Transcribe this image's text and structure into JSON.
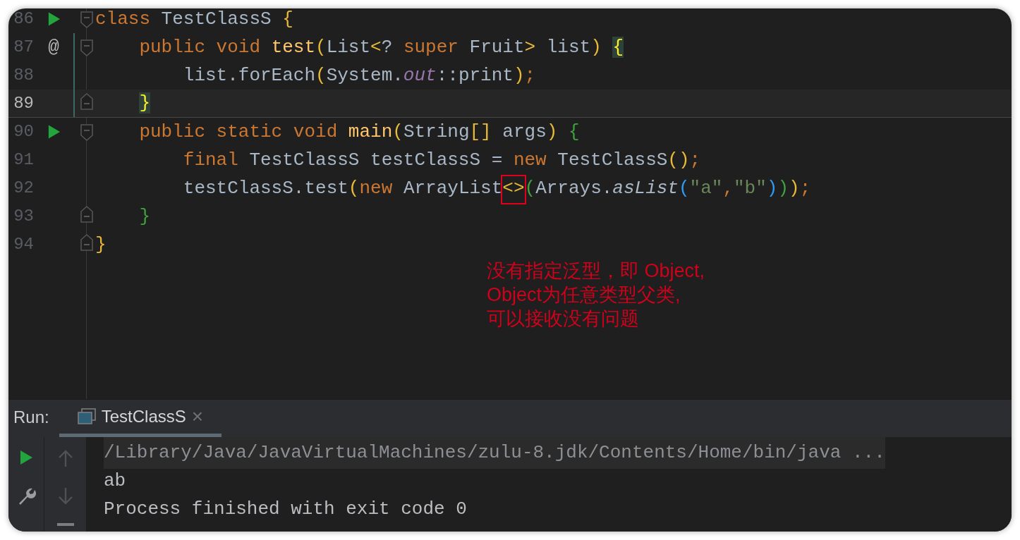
{
  "editor": {
    "lines": [
      {
        "number": "86",
        "gutter_icon": {
          "kind": "run"
        },
        "fold_marker": {
          "kind": "start"
        },
        "current": false,
        "changed": false,
        "separator_after": false,
        "tokens": [
          {
            "text": "class",
            "kind": "keyword"
          },
          {
            "text": " TestClassS ",
            "kind": "plain"
          },
          {
            "text": "{",
            "kind": "bracket1"
          }
        ],
        "children": [
          {
            "number": "87",
            "gutter_icon": {
              "kind": "text",
              "text": "@"
            },
            "fold_marker": {
              "kind": "start"
            },
            "current": false,
            "changed": true,
            "separator_after": false,
            "tokens": [
              {
                "text": "public void ",
                "kind": "keyword"
              },
              {
                "text": "test",
                "kind": "method"
              },
              {
                "text": "(",
                "kind": "bracket1"
              },
              {
                "text": "List",
                "kind": "plain"
              },
              {
                "text": "<",
                "kind": "bracket1"
              },
              {
                "text": "? ",
                "kind": "plain"
              },
              {
                "text": "super ",
                "kind": "keyword"
              },
              {
                "text": "Fruit",
                "kind": "plain"
              },
              {
                "text": ">",
                "kind": "bracket1"
              },
              {
                "text": " list",
                "kind": "plain"
              },
              {
                "text": ") ",
                "kind": "bracket1"
              },
              {
                "text": "{",
                "kind": "brace_match"
              }
            ],
            "children": [
              {
                "number": "88",
                "current": false,
                "changed": true,
                "separator_after": false,
                "tokens": [
                  {
                    "text": "list.forEach",
                    "kind": "plain"
                  },
                  {
                    "text": "(",
                    "kind": "bracket1"
                  },
                  {
                    "text": "System.",
                    "kind": "plain"
                  },
                  {
                    "text": "out",
                    "kind": "static_field"
                  },
                  {
                    "text": "::print",
                    "kind": "plain"
                  },
                  {
                    "text": ")",
                    "kind": "bracket1"
                  },
                  {
                    "text": ";",
                    "kind": "punct"
                  }
                ]
              }
            ]
          },
          {
            "number": "89",
            "fold_marker": {
              "kind": "end"
            },
            "current": true,
            "changed": true,
            "separator_after": true,
            "tokens": [
              {
                "text": "}",
                "kind": "brace_match"
              }
            ]
          },
          {
            "number": "90",
            "gutter_icon": {
              "kind": "run"
            },
            "fold_marker": {
              "kind": "start"
            },
            "current": false,
            "changed": false,
            "separator_after": false,
            "tokens": [
              {
                "text": "public static void ",
                "kind": "keyword"
              },
              {
                "text": "main",
                "kind": "method"
              },
              {
                "text": "(",
                "kind": "bracket1"
              },
              {
                "text": "String",
                "kind": "plain"
              },
              {
                "text": "[]",
                "kind": "bracket1"
              },
              {
                "text": " args",
                "kind": "plain"
              },
              {
                "text": ") ",
                "kind": "bracket1"
              },
              {
                "text": "{",
                "kind": "bracket2"
              }
            ],
            "children": [
              {
                "number": "91",
                "current": false,
                "changed": false,
                "separator_after": false,
                "tokens": [
                  {
                    "text": "final ",
                    "kind": "keyword"
                  },
                  {
                    "text": "TestClassS testClassS = ",
                    "kind": "plain"
                  },
                  {
                    "text": "new ",
                    "kind": "keyword"
                  },
                  {
                    "text": "TestClassS",
                    "kind": "plain"
                  },
                  {
                    "text": "()",
                    "kind": "bracket1"
                  },
                  {
                    "text": ";",
                    "kind": "punct"
                  }
                ]
              },
              {
                "number": "92",
                "current": false,
                "changed": false,
                "separator_after": false,
                "tokens": [
                  {
                    "text": "testClassS.test",
                    "kind": "plain"
                  },
                  {
                    "text": "(",
                    "kind": "bracket1"
                  },
                  {
                    "text": "new ",
                    "kind": "keyword"
                  },
                  {
                    "text": "ArrayList",
                    "kind": "plain"
                  },
                  {
                    "text": "<>",
                    "kind": "boxed"
                  },
                  {
                    "text": "(",
                    "kind": "bracket2"
                  },
                  {
                    "text": "Arrays.",
                    "kind": "plain"
                  },
                  {
                    "text": "asList",
                    "kind": "static_method"
                  },
                  {
                    "text": "(",
                    "kind": "bracket3"
                  },
                  {
                    "text": "\"a\"",
                    "kind": "string"
                  },
                  {
                    "text": ",",
                    "kind": "punct"
                  },
                  {
                    "text": "\"b\"",
                    "kind": "string"
                  },
                  {
                    "text": ")",
                    "kind": "bracket3"
                  },
                  {
                    "text": ")",
                    "kind": "bracket2"
                  },
                  {
                    "text": ")",
                    "kind": "bracket1"
                  },
                  {
                    "text": ";",
                    "kind": "punct"
                  }
                ]
              }
            ]
          },
          {
            "number": "93",
            "fold_marker": {
              "kind": "end"
            },
            "current": false,
            "changed": false,
            "separator_after": false,
            "tokens": [
              {
                "text": "}",
                "kind": "bracket2"
              }
            ]
          }
        ]
      },
      {
        "number": "94",
        "fold_marker": {
          "kind": "end"
        },
        "current": false,
        "changed": false,
        "separator_after": false,
        "tokens": [
          {
            "text": "}",
            "kind": "bracket1"
          }
        ]
      }
    ]
  },
  "annotation": {
    "lines": [
      "没有指定泛型，即 Object,",
      "Object为任意类型父类,",
      "可以接收没有问题"
    ]
  },
  "run_panel": {
    "label": "Run:",
    "tabs": [
      {
        "label": "TestClassS",
        "close": "×",
        "selected": true
      }
    ],
    "tools": [
      {
        "kind": "run"
      },
      {
        "kind": "wrench"
      }
    ],
    "nav": [
      {
        "kind": "up"
      },
      {
        "kind": "down"
      },
      {
        "kind": "bar"
      }
    ],
    "console": [
      {
        "text": "/Library/Java/JavaVirtualMachines/zulu-8.jdk/Contents/Home/bin/java ...",
        "kind": "command"
      },
      {
        "text": "ab",
        "kind": "output"
      },
      {
        "text": "Process finished with exit code 0",
        "kind": "output"
      }
    ]
  }
}
